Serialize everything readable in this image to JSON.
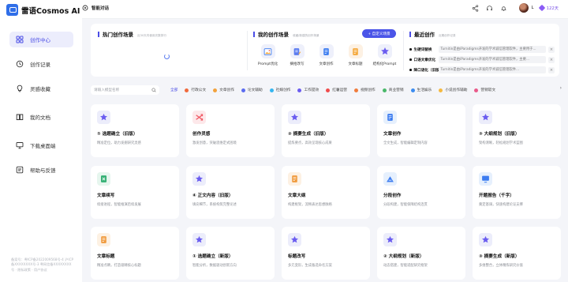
{
  "app": {
    "name": "雷语Cosmos AI"
  },
  "sidebar": {
    "items": [
      {
        "label": "创作中心",
        "icon": "grid-icon",
        "active": true
      },
      {
        "label": "创作记录",
        "icon": "clock-icon",
        "active": false
      },
      {
        "label": "灵感收藏",
        "icon": "bulb-icon",
        "active": false
      },
      {
        "label": "我的文档",
        "icon": "book-icon",
        "active": false
      },
      {
        "label": "下载桌面端",
        "icon": "monitor-icon",
        "active": false
      },
      {
        "label": "帮助与反馈",
        "icon": "help-icon",
        "active": false
      }
    ],
    "footer": "备案号：粤ICP备2022009568号-4 沪ICP备XXXXXXXX号-3 粤网信备XXXXXXXX号 · 隐私政策 · 用户协议"
  },
  "header": {
    "title": "智能对话",
    "user_initial": "L",
    "vip_count": "122天"
  },
  "hot": {
    "title": "热门创作场景",
    "subtitle": "近30天内使用次数排行"
  },
  "mine": {
    "title": "我的创作场景",
    "subtitle": "收藏/新建的创作场景",
    "button": "+ 自定义场景",
    "items": [
      {
        "label": "Prompt优化",
        "icon": "image-icon"
      },
      {
        "label": "摘拾改写",
        "icon": "pen-icon"
      },
      {
        "label": "文章创作",
        "icon": "doc-icon"
      },
      {
        "label": "文章标题",
        "icon": "file-icon"
      },
      {
        "label": "结构化Prompt",
        "icon": "star-icon"
      }
    ]
  },
  "recent": {
    "title": "最近创作",
    "subtitle": "近期创作记录",
    "items": [
      {
        "key": "生硬词替换",
        "value": "Turnitin是由iParadigms开发的学术诚信管理软件，主要用于..."
      },
      {
        "key": "口语文章优化",
        "value": "Turnitin是由iParadigms开发的学术诚信管理软件，主要..."
      },
      {
        "key": "降口语化（旧版）",
        "value": "Turnitin是由iParadigms开发的学术诚信管理软件..."
      }
    ]
  },
  "search": {
    "placeholder": "请输入模型名称"
  },
  "categories": [
    {
      "label": "全部",
      "color": "",
      "active": true
    },
    {
      "label": "行政公文",
      "color": "#f06a3c"
    },
    {
      "label": "文章创作",
      "color": "#f2a23c"
    },
    {
      "label": "论文辅助",
      "color": "#5b6cf0"
    },
    {
      "label": "社媒创作",
      "color": "#35b6f0"
    },
    {
      "label": "工作提效",
      "color": "#6b5cf0"
    },
    {
      "label": "红薯运营",
      "color": "#f04c4c"
    },
    {
      "label": "视频创作",
      "color": "#f07c3c"
    },
    {
      "label": "商业营销",
      "color": "#4ab86a"
    },
    {
      "label": "生活娱乐",
      "color": "#3c8cf0"
    },
    {
      "label": "小说创作辅助",
      "color": "#f5b940"
    },
    {
      "label": "营销软文",
      "color": "#e95a8a"
    }
  ],
  "cards": [
    {
      "title": "① 选题确立（旧版）",
      "desc": "精准定位，助力发掘研究灵感",
      "icon": "star-icon",
      "bg": "#ecedfb",
      "fg": "#6a5cf0"
    },
    {
      "title": "创作灵感",
      "desc": "激发创意，突破思维定式困境",
      "icon": "shuffle-icon",
      "bg": "#fde8ea",
      "fg": "#f05a64"
    },
    {
      "title": "② 摘要生成（旧版）",
      "desc": "提炼要点，高效呈现核心成果",
      "icon": "star-icon",
      "bg": "#ecedfb",
      "fg": "#6a5cf0"
    },
    {
      "title": "文章创作",
      "desc": "全文生成，智能编辑定制内容",
      "icon": "doc-icon",
      "bg": "#e6f0fd",
      "fg": "#3c7cf0"
    },
    {
      "title": "③ 大纲规划（旧版）",
      "desc": "架构清晰，轻松规划学术蓝图",
      "icon": "star-icon",
      "bg": "#ecedfb",
      "fg": "#6a5cf0"
    },
    {
      "title": "文章续写",
      "desc": "续接进程，智能推演后续发展",
      "icon": "book-icon",
      "bg": "#e6f6ee",
      "fg": "#33b073"
    },
    {
      "title": "④ 正文内容（旧版）",
      "desc": "填充细节，系统构筑完整论述",
      "icon": "star-icon",
      "bg": "#ecedfb",
      "fg": "#6a5cf0"
    },
    {
      "title": "文章大纲",
      "desc": "构建框架，流畅表达思想脉络",
      "icon": "file-icon",
      "bg": "#fdf1e3",
      "fg": "#f09a3c"
    },
    {
      "title": "分段创作",
      "desc": "分段构建，智能保障结构连贯",
      "icon": "mountain-icon",
      "bg": "#e6f0fd",
      "fg": "#3c7cf0"
    },
    {
      "title": "开题报告（千字）",
      "desc": "奠定基调，快速构建论证支撑",
      "icon": "monitor-icon",
      "bg": "#e6f0fd",
      "fg": "#3c7cf0"
    },
    {
      "title": "文章标题",
      "desc": "精准点睛，打造吸睛核心标题",
      "icon": "file-icon",
      "bg": "#fdf1e3",
      "fg": "#f09a3c"
    },
    {
      "title": "① 选题确立（新版）",
      "desc": "智能分析，数据驱动创新方向",
      "icon": "star-icon",
      "bg": "#ecedfb",
      "fg": "#6a5cf0"
    },
    {
      "title": "标题改写",
      "desc": "多元变形，生成备选命名方案",
      "icon": "star-icon",
      "bg": "#ecedfb",
      "fg": "#6a5cf0"
    },
    {
      "title": "② 大纲规划（新版）",
      "desc": "动态搭建，智能适配研究框架",
      "icon": "star-icon",
      "bg": "#ecedfb",
      "fg": "#6a5cf0"
    },
    {
      "title": "③ 摘要生成（新版）",
      "desc": "多维整合，立体精炼研究价值",
      "icon": "star-icon",
      "bg": "#ecedfb",
      "fg": "#6a5cf0"
    }
  ]
}
